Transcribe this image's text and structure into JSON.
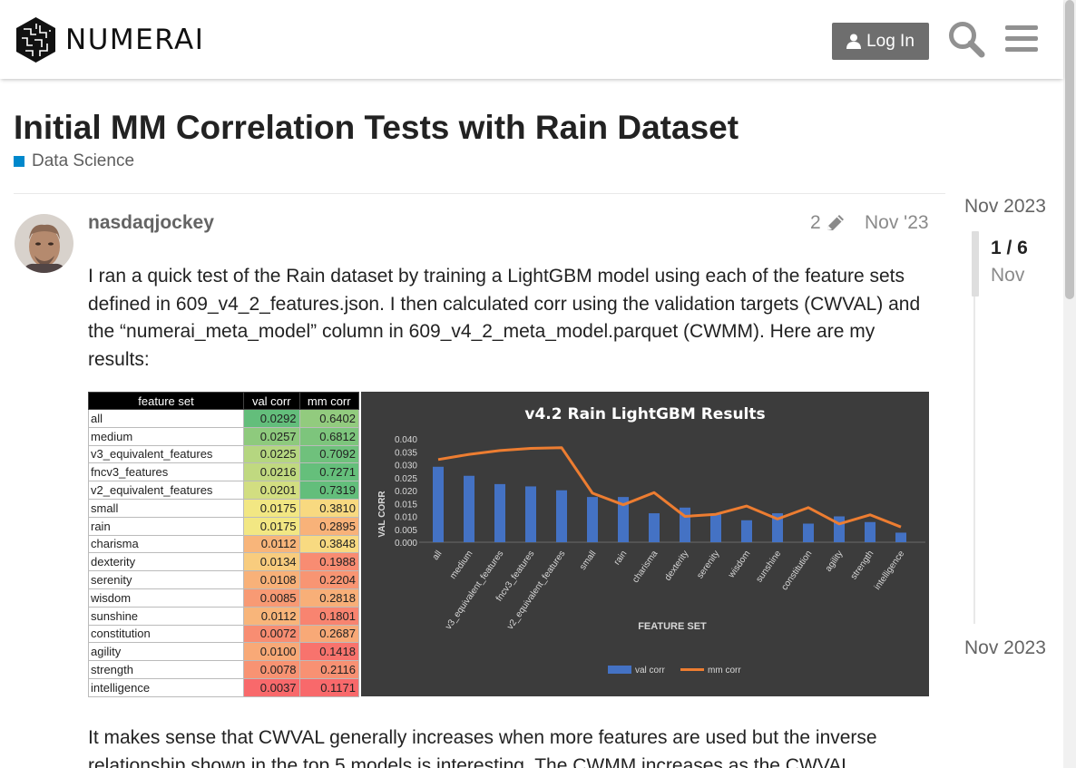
{
  "header": {
    "logo_text": "NUMERAI",
    "login_label": "Log In",
    "icons": [
      "numerai-logo-icon",
      "user-icon",
      "search-icon",
      "hamburger-menu-icon"
    ]
  },
  "topic": {
    "title": "Initial MM Correlation Tests with Rain Dataset",
    "category": "Data Science",
    "category_color": "#0088cc"
  },
  "post": {
    "username": "nasdaqjockey",
    "edit_count": "2",
    "date": "Nov '23",
    "paragraph1": "I ran a quick test of the Rain dataset by training a LightGBM model using each of the feature sets defined in 609_v4_2_features.json. I then calculated corr using the validation targets (CWVAL) and the “numerai_meta_model” column in 609_v4_2_meta_model.parquet (CWMM). Here are my results:",
    "paragraph2": "It makes sense that CWVAL generally increases when more features are used but the inverse relationship shown in the top 5 models is interesting. The CWMM increases as the CWVAL"
  },
  "table": {
    "headers": [
      "feature set",
      "val corr",
      "mm corr"
    ],
    "rows": [
      [
        "all",
        "0.0292",
        "0.6402"
      ],
      [
        "medium",
        "0.0257",
        "0.6812"
      ],
      [
        "v3_equivalent_features",
        "0.0225",
        "0.7092"
      ],
      [
        "fncv3_features",
        "0.0216",
        "0.7271"
      ],
      [
        "v2_equivalent_features",
        "0.0201",
        "0.7319"
      ],
      [
        "small",
        "0.0175",
        "0.3810"
      ],
      [
        "rain",
        "0.0175",
        "0.2895"
      ],
      [
        "charisma",
        "0.0112",
        "0.3848"
      ],
      [
        "dexterity",
        "0.0134",
        "0.1988"
      ],
      [
        "serenity",
        "0.0108",
        "0.2204"
      ],
      [
        "wisdom",
        "0.0085",
        "0.2818"
      ],
      [
        "sunshine",
        "0.0112",
        "0.1801"
      ],
      [
        "constitution",
        "0.0072",
        "0.2687"
      ],
      [
        "agility",
        "0.0100",
        "0.1418"
      ],
      [
        "strength",
        "0.0078",
        "0.2116"
      ],
      [
        "intelligence",
        "0.0037",
        "0.1171"
      ]
    ]
  },
  "chart_data": {
    "type": "bar",
    "title": "v4.2 Rain LightGBM Results",
    "xlabel": "FEATURE SET",
    "ylabel": "VAL CORR",
    "ylim": [
      0,
      0.04
    ],
    "yticks": [
      "0.000",
      "0.005",
      "0.010",
      "0.015",
      "0.020",
      "0.025",
      "0.030",
      "0.035",
      "0.040"
    ],
    "categories": [
      "all",
      "medium",
      "v3_equivalent_features",
      "fncv3_features",
      "v2_equivalent_features",
      "small",
      "rain",
      "charisma",
      "dexterity",
      "serenity",
      "wisdom",
      "sunshine",
      "constitution",
      "agility",
      "strength",
      "intelligence"
    ],
    "series": [
      {
        "name": "val corr",
        "kind": "bar",
        "color": "#4472c4",
        "values": [
          0.0292,
          0.0257,
          0.0225,
          0.0216,
          0.0201,
          0.0175,
          0.0175,
          0.0112,
          0.0134,
          0.0108,
          0.0085,
          0.0112,
          0.0072,
          0.01,
          0.0078,
          0.0037
        ]
      },
      {
        "name": "mm corr",
        "kind": "line",
        "color": "#ed7d31",
        "values": [
          0.032,
          0.034,
          0.0355,
          0.0363,
          0.0366,
          0.019,
          0.0145,
          0.0192,
          0.01,
          0.0108,
          0.014,
          0.009,
          0.0134,
          0.0071,
          0.0106,
          0.0059
        ]
      }
    ],
    "legend_position": "bottom",
    "grid": false
  },
  "timeline": {
    "top_date": "Nov 2023",
    "count": "1 / 6",
    "current": "Nov",
    "bottom_date": "Nov 2023"
  }
}
